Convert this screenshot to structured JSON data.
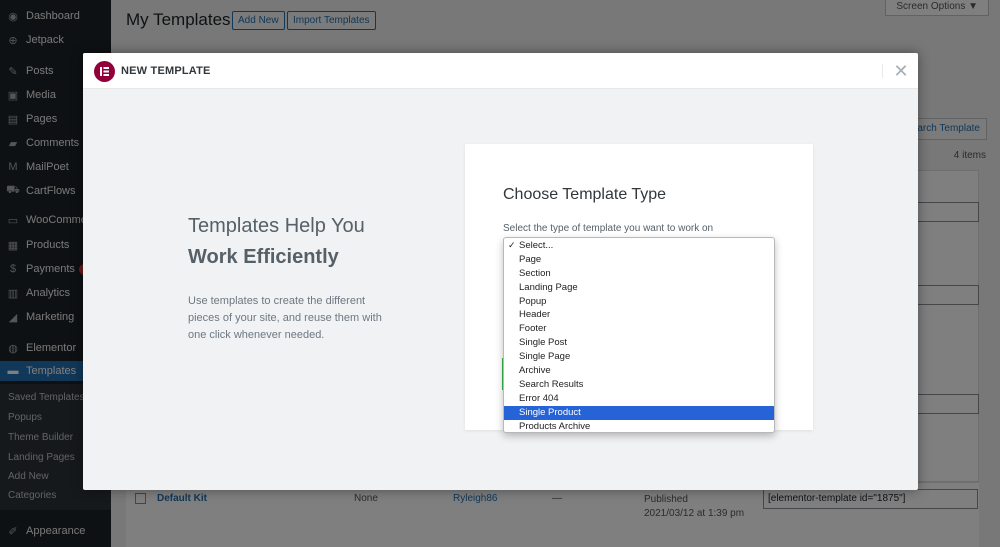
{
  "sidebar": {
    "items": [
      {
        "label": "Dashboard",
        "icon": "dashboard-icon",
        "glyph": "◉"
      },
      {
        "label": "Jetpack",
        "icon": "jetpack-icon",
        "glyph": "⊕"
      },
      {
        "label": "Posts",
        "icon": "pin-icon",
        "glyph": "✎"
      },
      {
        "label": "Media",
        "icon": "media-icon",
        "glyph": "▣"
      },
      {
        "label": "Pages",
        "icon": "pages-icon",
        "glyph": "▤"
      },
      {
        "label": "Comments",
        "icon": "comments-icon",
        "glyph": "▰"
      },
      {
        "label": "MailPoet",
        "icon": "mailpoet-icon",
        "glyph": "M"
      },
      {
        "label": "CartFlows",
        "icon": "cartflows-icon",
        "glyph": "⛟"
      },
      {
        "label": "WooCommerce",
        "icon": "woocommerce-icon",
        "glyph": "▭"
      },
      {
        "label": "Products",
        "icon": "products-icon",
        "glyph": "▦"
      },
      {
        "label": "Payments",
        "icon": "payments-icon",
        "glyph": "$"
      },
      {
        "label": "Analytics",
        "icon": "analytics-icon",
        "glyph": "▥"
      },
      {
        "label": "Marketing",
        "icon": "marketing-icon",
        "glyph": "◢"
      },
      {
        "label": "Elementor",
        "icon": "elementor-icon",
        "glyph": "◍"
      },
      {
        "label": "Templates",
        "icon": "folder-icon",
        "glyph": "▬"
      },
      {
        "label": "Appearance",
        "icon": "appearance-icon",
        "glyph": "✐"
      }
    ],
    "submenu": [
      "Saved Templates",
      "Popups",
      "Theme Builder",
      "Landing Pages",
      "Add New",
      "Categories"
    ]
  },
  "page": {
    "title": "My Templates",
    "add_new": "Add New",
    "import_templates": "Import Templates",
    "screen_options": "Screen Options ▼",
    "search_button": "arch Template",
    "items_count": "4 items"
  },
  "table_row": {
    "title": "Default Kit",
    "type": "None",
    "author": "Ryleigh86",
    "dash": "—",
    "status": "Published",
    "date": "2021/03/12 at 1:39 pm",
    "shortcode": "[elementor-template id=\"1875\"]"
  },
  "modal": {
    "title": "NEW TEMPLATE",
    "close_glyph": "✕",
    "heading_line1": "Templates Help You",
    "heading_line2": "Work Efficiently",
    "description": "Use templates to create the different pieces of your site, and reuse them with one click whenever needed.",
    "card_title": "Choose Template Type",
    "card_subtitle": "Select the type of template you want to work on"
  },
  "dropdown": {
    "check": "✓",
    "options": [
      "Select...",
      "Page",
      "Section",
      "Landing Page",
      "Popup",
      "Header",
      "Footer",
      "Single Post",
      "Single Page",
      "Archive",
      "Search Results",
      "Error 404",
      "Single Product",
      "Products Archive"
    ],
    "checked_index": 0,
    "highlighted_index": 12
  },
  "colors": {
    "sidebar_bg": "#1d2327",
    "wp_blue": "#2271b1",
    "elementor_brand": "#92003b",
    "highlight": "#2563d6"
  }
}
